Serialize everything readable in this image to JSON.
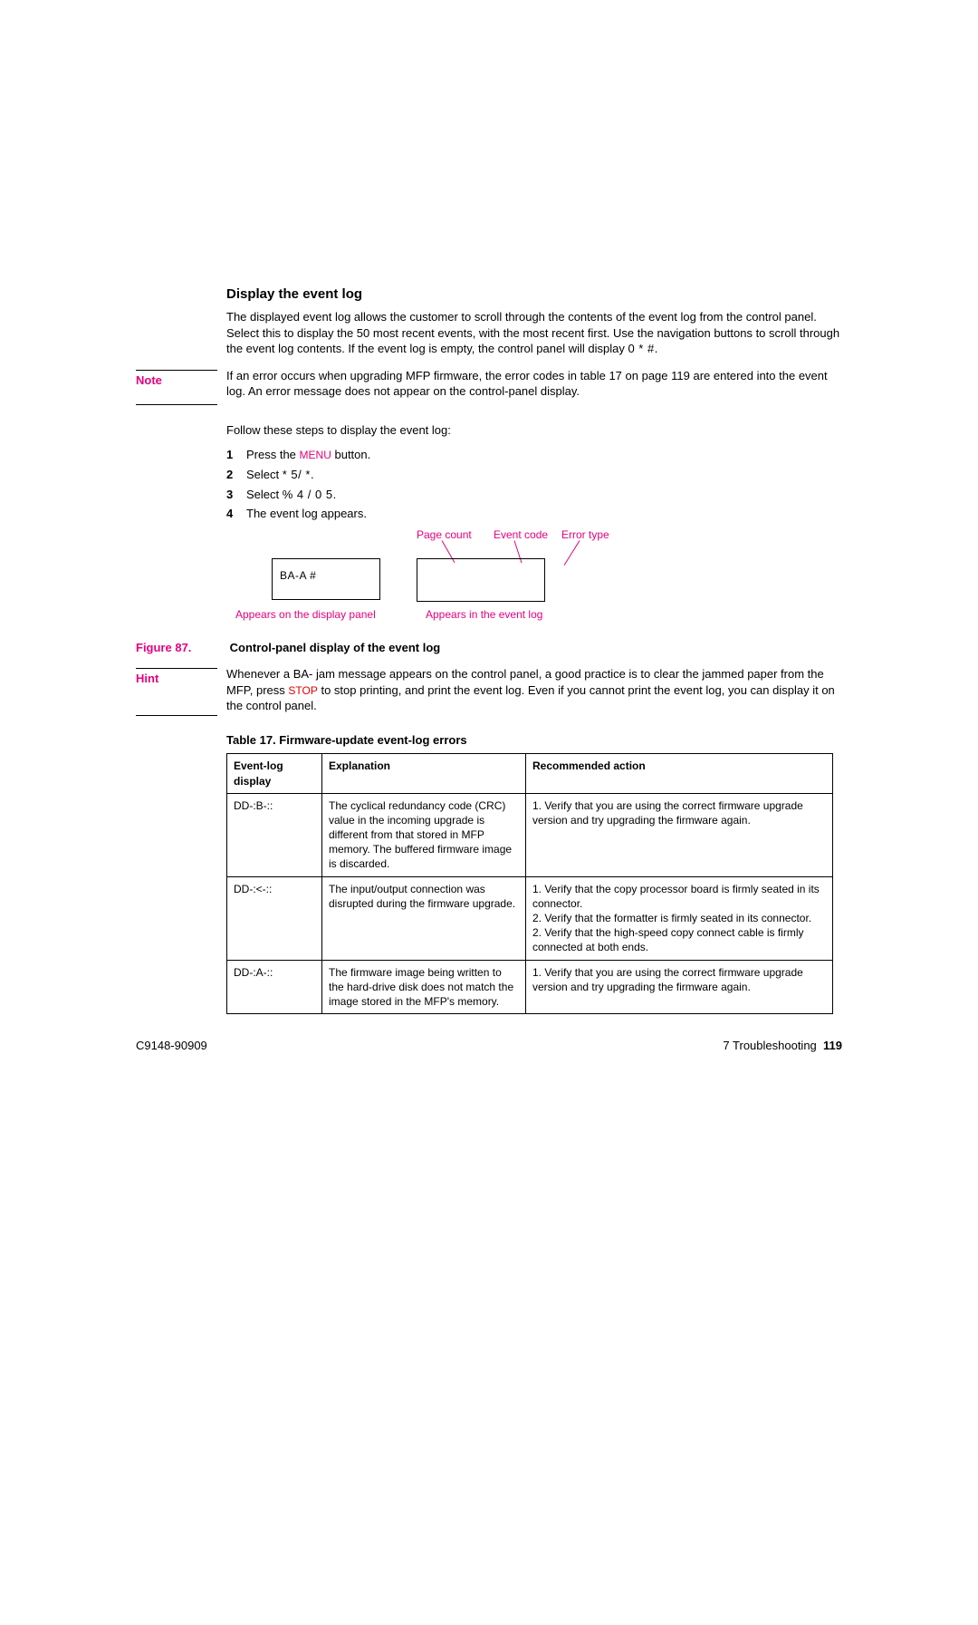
{
  "heading": "Display the event log",
  "intro": "The displayed event log allows the customer to scroll through the contents of the event log from the control panel. Select this to display the 50 most recent events, with the most recent first. Use the navigation buttons to scroll through the event log contents. If the event log is empty, the control panel will display",
  "intro_code": "0   *   #",
  "intro_tail": ".",
  "note": {
    "label": "Note",
    "text": "If an error occurs when upgrading MFP firmware, the error codes in table 17 on page 119 are entered into the event log. An error message does not appear on the control-panel display."
  },
  "follow": "Follow these steps to display the event log:",
  "steps": [
    {
      "num": "1",
      "pre": "Press the ",
      "menu": "MENU",
      "post": " button."
    },
    {
      "num": "2",
      "pre": "Select ",
      "code": "* 5/   *",
      "post": "."
    },
    {
      "num": "3",
      "pre": "Select ",
      "code": "%   4 /  0 5",
      "post": "."
    },
    {
      "num": "4",
      "pre": "The event log appears.",
      "code": "",
      "post": ""
    }
  ],
  "diagram": {
    "page_count": "Page count",
    "event_code": "Event code",
    "error_type": "Error type",
    "box1_text": "BA-A        #",
    "left_caption": "Appears on the display panel",
    "right_caption": "Appears in the event log"
  },
  "figure": {
    "label": "Figure 87.",
    "caption": "Control-panel display of the event log"
  },
  "hint": {
    "label": "Hint",
    "pre": "Whenever a BA-    jam message appears on the control panel, a good practice is to clear the jammed paper from the MFP, press ",
    "stop": "STOP",
    "post": " to stop printing, and print the event log. Even if you cannot print the event log, you can display it on the control panel."
  },
  "table": {
    "caption": "Table 17. Firmware-update event-log errors",
    "headers": {
      "col1": "Event-log display",
      "col2": "Explanation",
      "col3": "Recommended action"
    },
    "rows": [
      {
        "c1": "DD-:B-::",
        "c2": "The cyclical redundancy code (CRC) value in the incoming upgrade is different from that stored in MFP memory. The buffered firmware image is discarded.",
        "c3": "1. Verify that you are using the correct firmware upgrade version and try upgrading the firmware again."
      },
      {
        "c1": "DD-:<-::",
        "c2": "The input/output connection was disrupted during the firmware upgrade.",
        "c3": "1. Verify that the copy processor board is firmly seated in its connector.\n2. Verify that the formatter is firmly seated in its connector.\n2. Verify that the high-speed copy connect cable is firmly connected at both ends."
      },
      {
        "c1": "DD-:A-::",
        "c2": "The firmware image being written to the hard-drive disk does not match the image stored in the MFP's memory.",
        "c3": "1. Verify that you are using the correct firmware upgrade version and try upgrading the firmware again."
      }
    ]
  },
  "footer": {
    "left": "C9148-90909",
    "right_prefix": "7 Troubleshooting",
    "right_page": "119"
  }
}
